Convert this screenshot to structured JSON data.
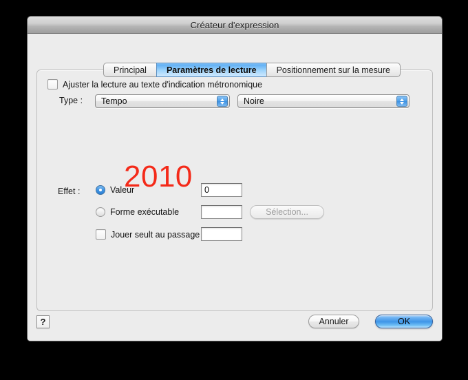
{
  "window": {
    "title": "Créateur d'expression"
  },
  "tabs": [
    {
      "label": "Principal",
      "selected": false
    },
    {
      "label": "Paramètres de lecture",
      "selected": true
    },
    {
      "label": "Positionnement sur la mesure",
      "selected": false
    }
  ],
  "panel": {
    "adjust_checkbox": {
      "label": "Ajuster la lecture au texte d'indication métronomique",
      "checked": false
    },
    "type_row": {
      "label": "Type :",
      "type_popup_value": "Tempo",
      "note_popup_value": "Noire"
    },
    "preview": {
      "text": "2010",
      "color": "#f42a19"
    },
    "effect": {
      "label": "Effet :",
      "options": [
        {
          "label": "Valeur",
          "selected": true,
          "value": "0"
        },
        {
          "label": "Forme exécutable",
          "selected": false,
          "value": "",
          "button_label": "Sélection...",
          "button_disabled": true
        }
      ],
      "play_only_on_pass": {
        "label": "Jouer seult au passage :",
        "checked": false,
        "value": ""
      }
    }
  },
  "footer": {
    "help_label": "?",
    "cancel_label": "Annuler",
    "ok_label": "OK"
  },
  "icons": {
    "stepper_up": "triangle-up-icon",
    "stepper_down": "triangle-down-icon"
  }
}
